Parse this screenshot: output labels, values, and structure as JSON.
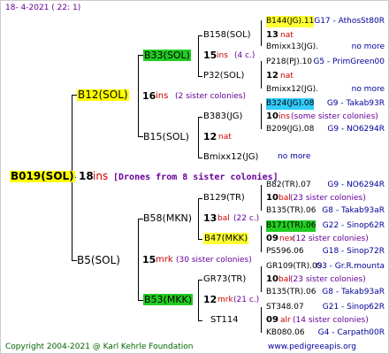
{
  "header": "18-  4-2021 (  22:   1)",
  "footer_left": "Copyright 2004-2021 @ Karl Kehrle Foundation",
  "footer_right": "www.pedigreeapis.org",
  "root": {
    "name": "B019(SOL)",
    "num": "18",
    "ins": "ins",
    "note": "[Drones from 8 sister colonies]"
  },
  "father": {
    "name": "B12(SOL)",
    "num": "16",
    "ins": "ins",
    "note": "(2 sister colonies)"
  },
  "mother": {
    "name": "B5(SOL)",
    "num": "15",
    "ins": "mrk",
    "note": "(30 sister colonies)"
  },
  "ff": {
    "name": "B33(SOL)",
    "num": "15",
    "ins": "ins",
    "note": "(4 c.)"
  },
  "fm": {
    "name": "B15(SOL)",
    "num": "12",
    "ins": "nat"
  },
  "mf": {
    "name": "B58(MKN)",
    "num": "13",
    "ins": "bal",
    "note": "(22 c.)"
  },
  "mm": {
    "name": "B53(MKK)",
    "num": "12",
    "ins": "mrk",
    "note": "(21 c.)"
  },
  "g3": [
    {
      "name": "B158(SOL)"
    },
    {
      "name": "P32(SOL)"
    },
    {
      "name": "B383(JG)"
    },
    {
      "name": "Bmixx12(JG)"
    },
    {
      "name": "B129(TR)"
    },
    {
      "name": "B47(MKK)"
    },
    {
      "name": "GR73(TR)"
    },
    {
      "name": "ST114"
    }
  ],
  "g3_nums": {
    "a": {
      "num": "13",
      "ins": "nat"
    },
    "b": {
      "num": "12",
      "ins": "nat"
    },
    "c": {
      "num": "10",
      "ins": "ins",
      "note": "(some sister colonies)"
    },
    "d": {
      "num": "10",
      "ins": "bal",
      "note": "(23 sister colonies)"
    },
    "e": {
      "num": "09",
      "ins": "nex",
      "note": "(12 sister colonies)"
    },
    "f": {
      "num": "10",
      "ins": "bal",
      "note": "(23 sister colonies)"
    },
    "g": {
      "num": "09",
      "ins": "alr",
      "note": "(14 sister colonies)"
    }
  },
  "g4": [
    {
      "name": "B144(JG).11",
      "line": "G17 - AthosSt80R"
    },
    {
      "name": "Bmixx13(JG).",
      "line": "no more"
    },
    {
      "name": "P218(PJ).10",
      "line": "G5 - PrimGreen00"
    },
    {
      "name": "Bmixx12(JG).",
      "line": "no more"
    },
    {
      "name": "B324(JG).08",
      "line": "G9 - Takab93R"
    },
    {
      "name": "B209(JG).08",
      "line": "G9 - NO6294R"
    },
    {
      "name": "no more",
      "line": ""
    },
    {
      "name": "B82(TR).07",
      "line": "G9 - NO6294R"
    },
    {
      "name": "B135(TR).06",
      "line": "G8 - Takab93aR"
    },
    {
      "name": "B171(TR).06",
      "line": "G22 - Sinop62R"
    },
    {
      "name": "PS596.06",
      "line": "G18 - Sinop72R"
    },
    {
      "name": "GR109(TR).09",
      "line": "G3 - Gr.R.mounta"
    },
    {
      "name": "B135(TR).06",
      "line": "G8 - Takab93aR"
    },
    {
      "name": "ST348.07",
      "line": "G21 - Sinop62R"
    },
    {
      "name": "KB080.06",
      "line": "G4 - Carpath00R"
    }
  ],
  "colors": {
    "highlight_yellow": "#ffff00",
    "highlight_green": "#22cc22",
    "highlight_cyan": "#33ccff",
    "red": "#cc0000",
    "blue": "#000099",
    "purple": "#660099",
    "green": "#006600"
  }
}
